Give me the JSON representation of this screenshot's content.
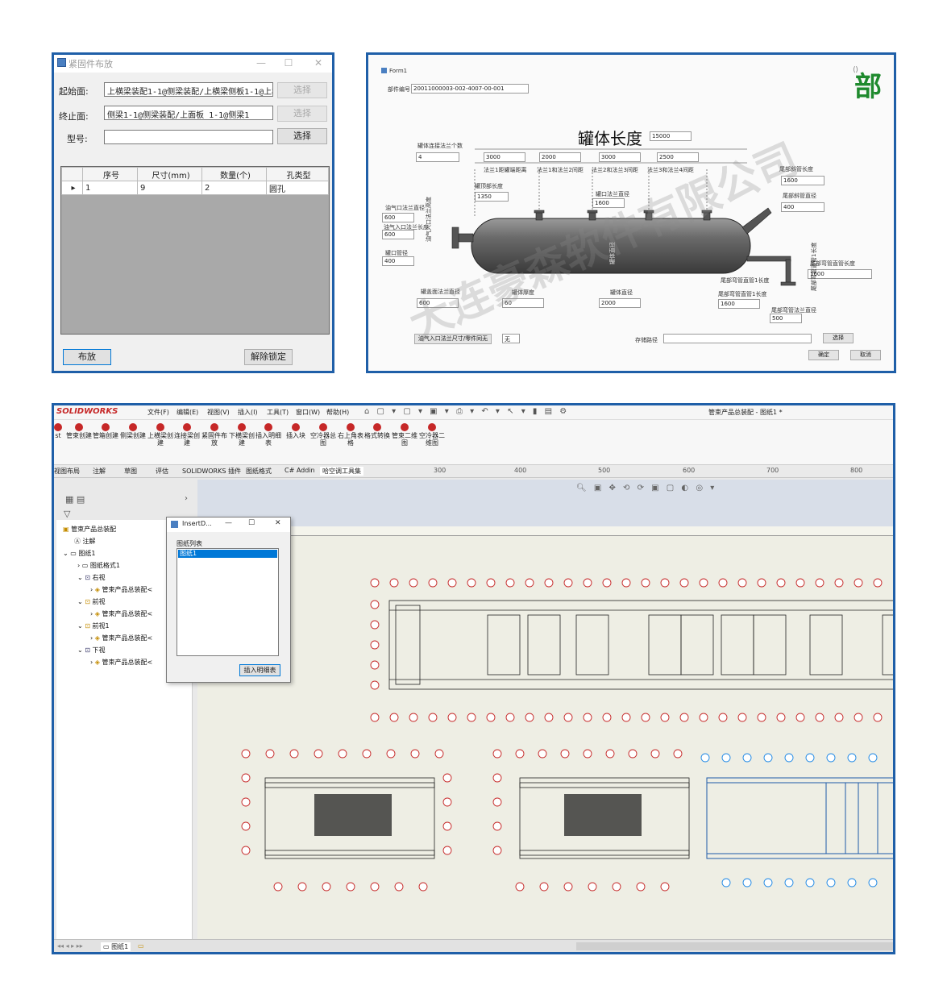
{
  "fastener_dialog": {
    "title": "紧固件布放",
    "window_controls": [
      "—",
      "☐",
      "✕"
    ],
    "start_label": "起始面:",
    "start_value": "上横梁装配1-1@侧梁装配/上横梁侧板1-1@上横",
    "end_label": "终止面:",
    "end_value": "侧梁1-1@侧梁装配/上面板_1-1@侧梁1",
    "model_label": "型号:",
    "model_value": "",
    "select_label": "选择",
    "columns": [
      "序号",
      "尺寸(mm)",
      "数量(个)",
      "孔类型"
    ],
    "row_marker": "▸",
    "rows": [
      [
        "1",
        "9",
        "2",
        "圆孔"
      ]
    ],
    "place_button": "布放",
    "unlock_button": "解除锁定"
  },
  "tank_form": {
    "title": "Form1",
    "watermark": "大连豪森软件有限公司",
    "corner_text": "部",
    "part_no_label": "部件编号",
    "part_no_value": "20011000003-002-4007-00-001",
    "length_title": "罐体长度",
    "length_value": "15000",
    "flange_count_label": "罐体连接法兰个数",
    "flange_count_value": "4",
    "segments": [
      "3000",
      "2000",
      "3000",
      "2500"
    ],
    "segment_labels": [
      "法兰1距罐端距离",
      "法兰1和法兰2间距",
      "法兰2和法兰3间距",
      "法兰3和法兰4间距"
    ],
    "head_len_label": "罐顶部长度",
    "head_len_value": "1350",
    "inlet_dia_label": "油气口法兰直径",
    "inlet_dia_value": "600",
    "inlet_len_label": "油气入口法兰长度",
    "inlet_len_value": "600",
    "inlet_pipe_label": "罐口管径",
    "inlet_pipe_value": "400",
    "inlet_face_label": "油气入口法兰高度",
    "outlet_dia_label": "罐口法兰直径",
    "outlet_dia_value": "1600",
    "tail_long_label": "尾部斜管长度",
    "tail_long_value": "1600",
    "tail_dia_label": "尾部斜管直径",
    "tail_dia_value": "400",
    "tail_bend_label": "尾部弯管直管长度",
    "tail_bend_value": "1600",
    "tail_bend2_label": "尾部弯管直管1长度",
    "tail_pipe_label": "尾部弯管直管1长度",
    "tail_pipe_value": "1600",
    "tail_flange_label": "尾部弯管法兰直径",
    "tail_flange_value": "500",
    "shell_dia_label": "罐体直径",
    "head_flange_label": "罐盖面法兰直径",
    "head_flange_value": "600",
    "thickness_label": "罐体厚度",
    "thickness_value": "60",
    "body_dia_label": "罐体直径",
    "body_dia_value": "2000",
    "bottom_button": "油气入口法兰尺寸/零件同无",
    "none_value": "无",
    "save_label": "存储路径",
    "select_button": "选择",
    "ok_button": "确定",
    "cancel_button": "取消"
  },
  "solidworks": {
    "brand": "SOLIDWORKS",
    "menus": [
      "文件(F)",
      "编辑(E)",
      "视图(V)",
      "插入(I)",
      "工具(T)",
      "窗口(W)",
      "帮助(H)"
    ],
    "doc_title": "管束产品总装配 - 图纸1 *",
    "ribbon_tools": [
      "st",
      "管束创建",
      "管箱创建",
      "侧梁创建",
      "上横梁创建",
      "连接梁创建",
      "紧固件布放",
      "下横梁创建",
      "插入明细表",
      "插入块",
      "空冷器总图",
      "右上角表格",
      "格式转换",
      "管束二维图",
      "空冷器二维图"
    ],
    "tabs": [
      "视图布局",
      "注解",
      "草图",
      "评估",
      "SOLIDWORKS 插件",
      "图纸格式",
      "C# Addin",
      "哈空调工具集"
    ],
    "ruler": [
      "300",
      "400",
      "500",
      "600",
      "700",
      "800"
    ],
    "tree": {
      "root": "管束产品总装配",
      "annotations": "注解",
      "sheet": "图纸1",
      "sheet_format": "图纸格式1",
      "view_right": "右视",
      "view_front": "前视",
      "view_front1": "前视1",
      "view_bottom": "下视",
      "assembly_ref": "管束产品总装配<"
    },
    "insert_dialog": {
      "title": "InsertD...",
      "list_label": "图纸列表",
      "list_items": [
        "图纸1"
      ],
      "insert_button": "插入明细表"
    },
    "status_tab": "图纸1"
  }
}
